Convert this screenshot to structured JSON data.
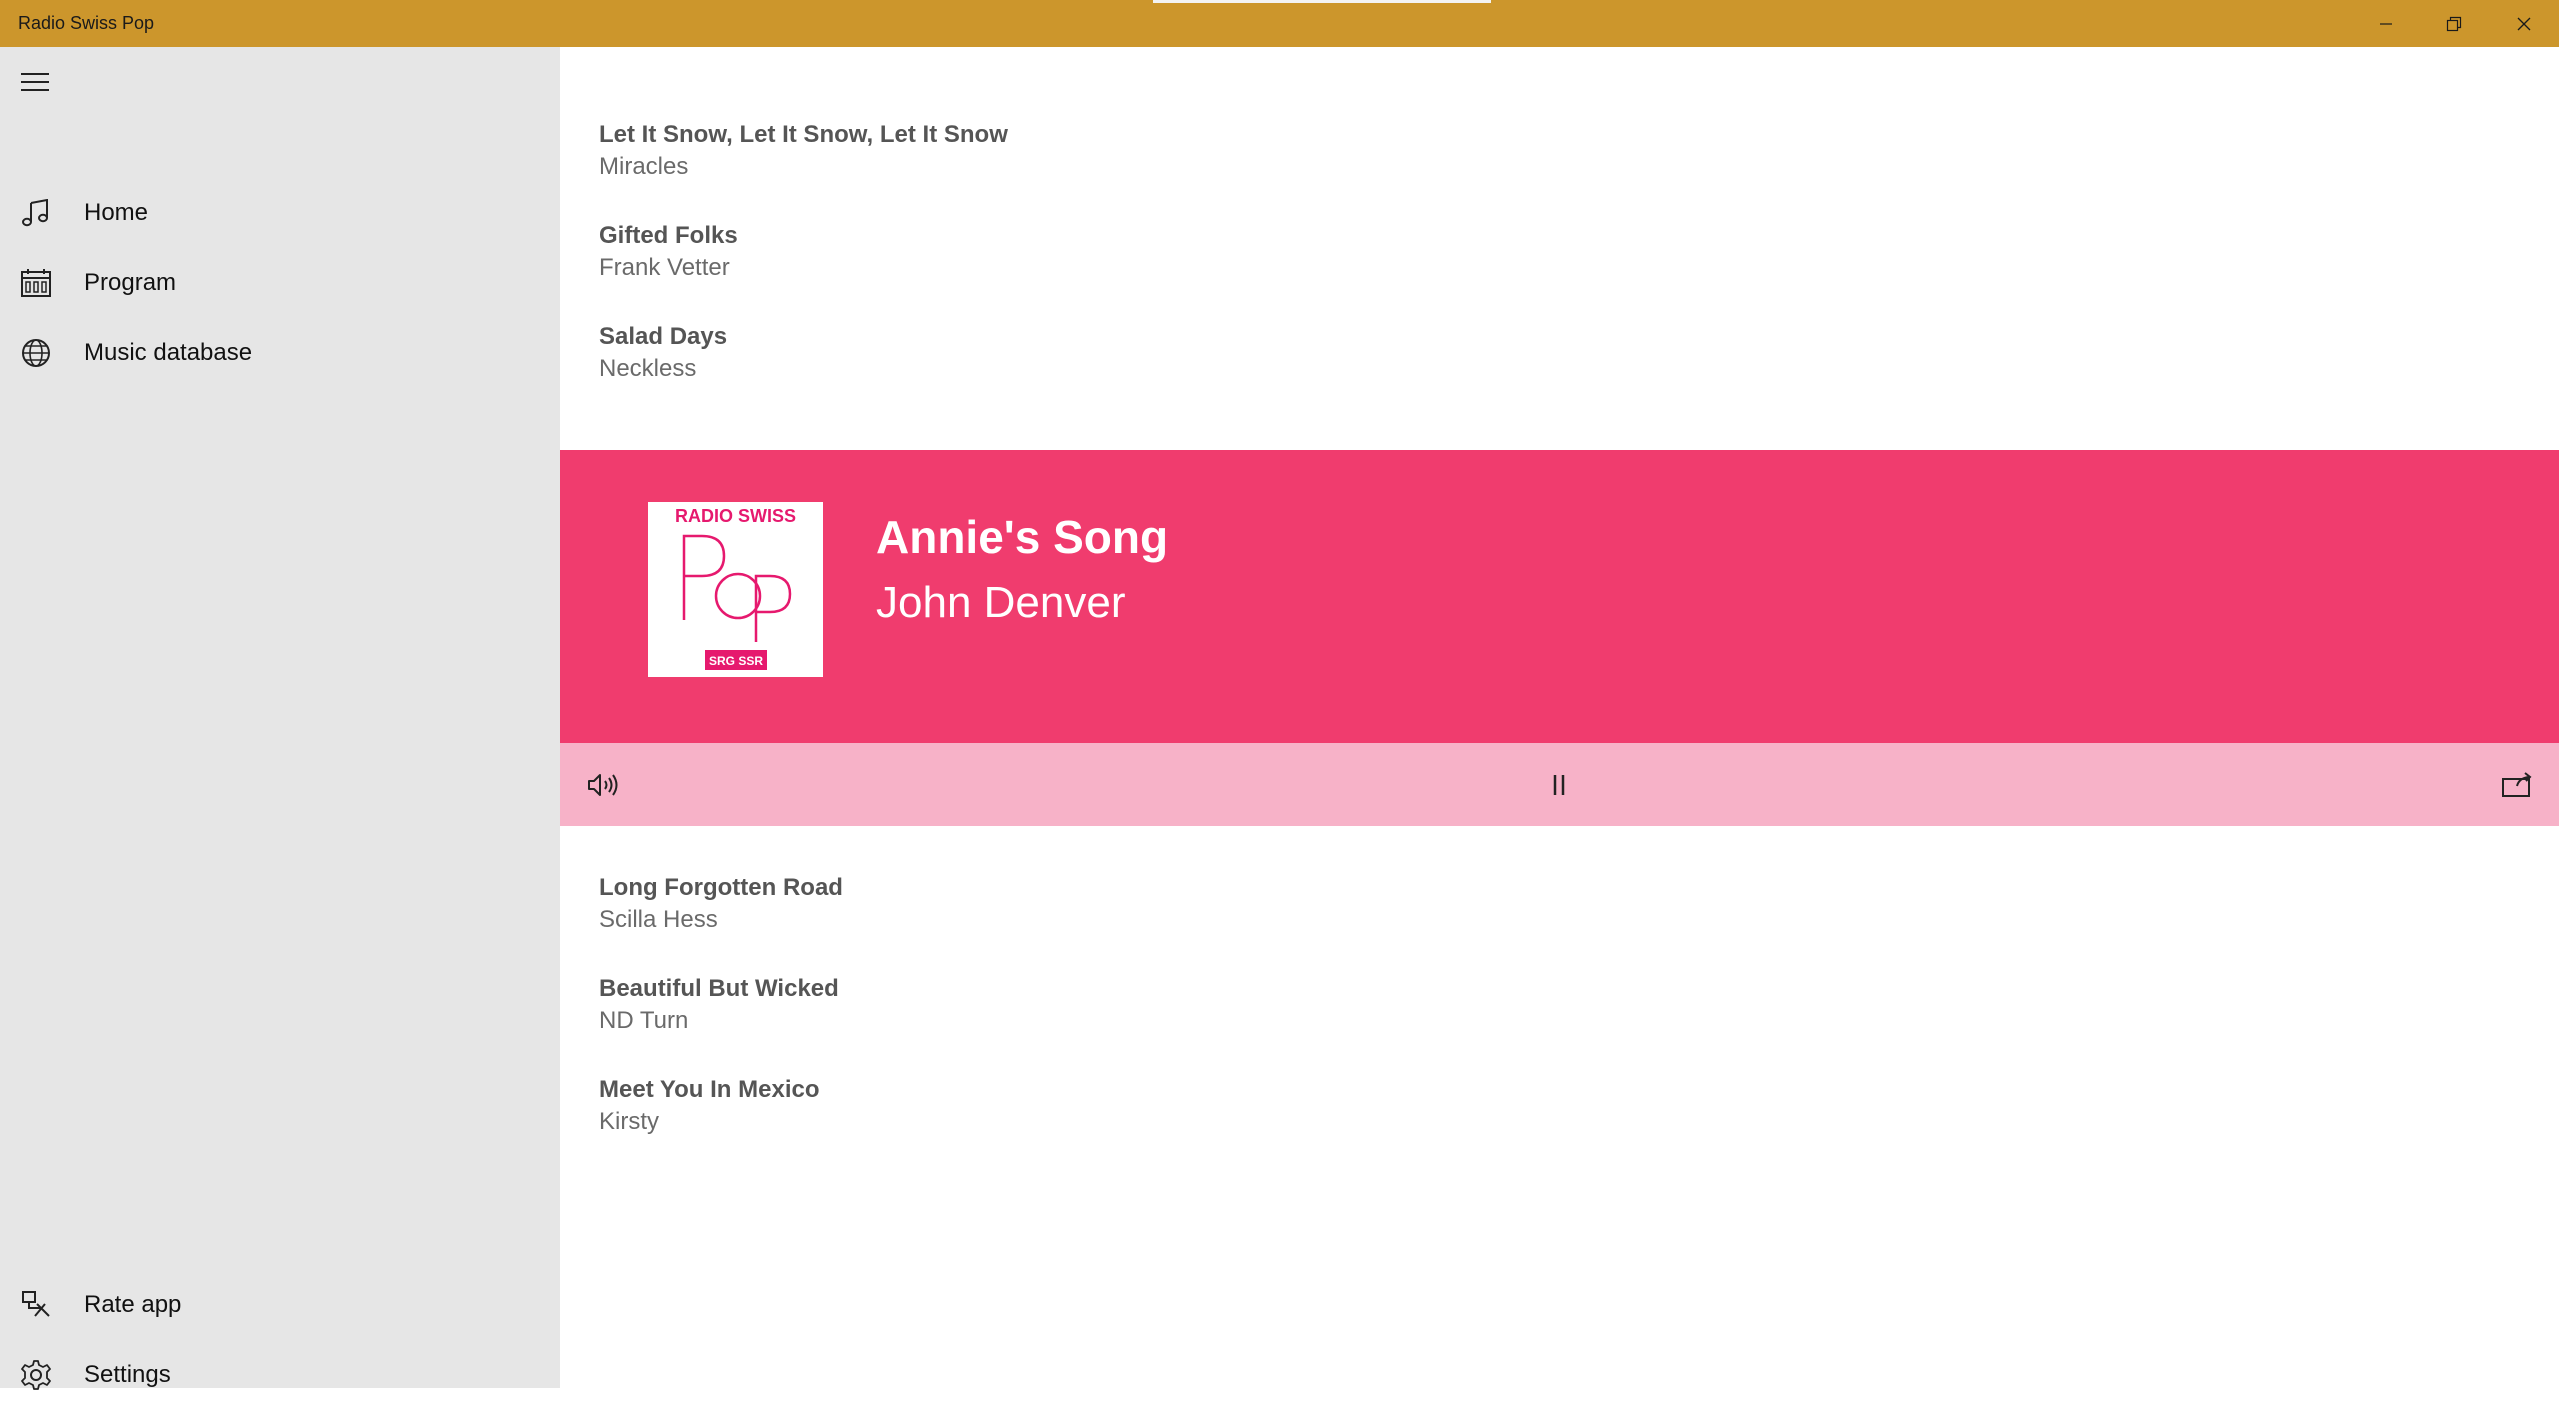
{
  "window": {
    "title": "Radio Swiss Pop"
  },
  "sidebar": {
    "nav_items": [
      {
        "label": "Home",
        "icon": "music-note-icon"
      },
      {
        "label": "Program",
        "icon": "calendar-icon"
      },
      {
        "label": "Music database",
        "icon": "globe-icon"
      }
    ],
    "footer_items": [
      {
        "label": "Rate app",
        "icon": "rate-icon"
      },
      {
        "label": "Settings",
        "icon": "gear-icon"
      }
    ]
  },
  "recent_tracks": [
    {
      "title": "Let It Snow, Let It Snow, Let It Snow",
      "artist": "Miracles"
    },
    {
      "title": "Gifted Folks",
      "artist": "Frank Vetter"
    },
    {
      "title": "Salad Days",
      "artist": "Neckless"
    }
  ],
  "now_playing": {
    "title": "Annie's Song",
    "artist": "John Denver",
    "logo": {
      "top_text": "RADIO SWISS",
      "main_text": "POP",
      "badge_text": "SRG SSR"
    }
  },
  "upcoming_tracks": [
    {
      "title": "Long Forgotten Road",
      "artist": "Scilla Hess"
    },
    {
      "title": "Beautiful But Wicked",
      "artist": "ND Turn"
    },
    {
      "title": "Meet You In Mexico",
      "artist": "Kirsty"
    }
  ],
  "colors": {
    "titlebar": "#cc962c",
    "now_playing_bg": "#f03c6e",
    "controls_bg": "#f7b2c8",
    "sidebar_bg": "#e6e6e6"
  }
}
